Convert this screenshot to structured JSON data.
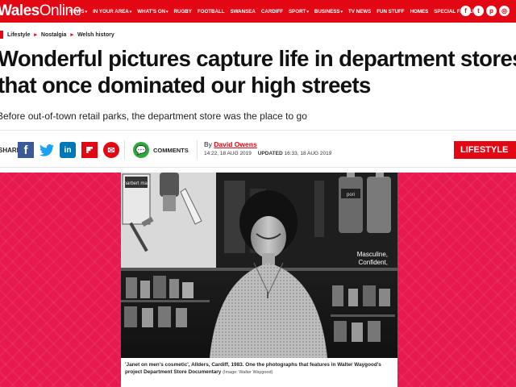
{
  "site": {
    "logo_bold": "Wales",
    "logo_light": "Online"
  },
  "nav": {
    "items": [
      {
        "label": "NEWS",
        "caret": "▾"
      },
      {
        "label": "IN YOUR AREA",
        "caret": "▾"
      },
      {
        "label": "WHAT'S ON",
        "caret": "▾"
      },
      {
        "label": "RUGBY",
        "caret": ""
      },
      {
        "label": "FOOTBALL",
        "caret": ""
      },
      {
        "label": "SWANSEA",
        "caret": ""
      },
      {
        "label": "CARDIFF",
        "caret": ""
      },
      {
        "label": "SPORT",
        "caret": "▾"
      },
      {
        "label": "BUSINESS",
        "caret": "▾"
      },
      {
        "label": "TV NEWS",
        "caret": ""
      },
      {
        "label": "FUN STUFF",
        "caret": ""
      },
      {
        "label": "HOMES",
        "caret": ""
      },
      {
        "label": "SPECIAL FEATURES",
        "caret": ""
      }
    ],
    "social": [
      {
        "icon": "facebook-icon",
        "glyph": "f"
      },
      {
        "icon": "twitter-icon",
        "glyph": "t"
      },
      {
        "icon": "pinterest-icon",
        "glyph": "p"
      },
      {
        "icon": "instagram-icon",
        "glyph": "◎"
      }
    ]
  },
  "breadcrumb": [
    "Lifestyle",
    "Nostalgia",
    "Welsh history"
  ],
  "article": {
    "headline_line1": "Wonderful pictures capture life in department stores",
    "headline_line2": "that once dominated our high streets",
    "standfirst": "Before out-of-town retail parks, the department store was the place to go",
    "share_label": "SHARE",
    "comments_label": "COMMENTS",
    "byline_prefix": "By",
    "author": "David Owens",
    "published": "14:22, 18 AUG 2019",
    "updated_label": "UPDATED",
    "updated": "16:33, 18 AUG 2019",
    "tag": "LIFESTYLE"
  },
  "photo": {
    "box_text": "marbert man",
    "sign_text1": "Masculine,",
    "sign_text2": "Confident,",
    "bottle_text": "pori"
  },
  "caption": {
    "text": "'Janet on men's cosmetic', Allders, Cardiff, 1983. One the photographs that features in Walter Waygood's project Department Store Documentary",
    "credit": "(Image: Walter Waygood)"
  },
  "colors": {
    "brand_red": "#e30613",
    "panel_pink": "#e8194f",
    "facebook": "#3b5998",
    "twitter": "#1da1f2",
    "linkedin": "#0077b5",
    "comments_green": "#2eaa3c"
  }
}
